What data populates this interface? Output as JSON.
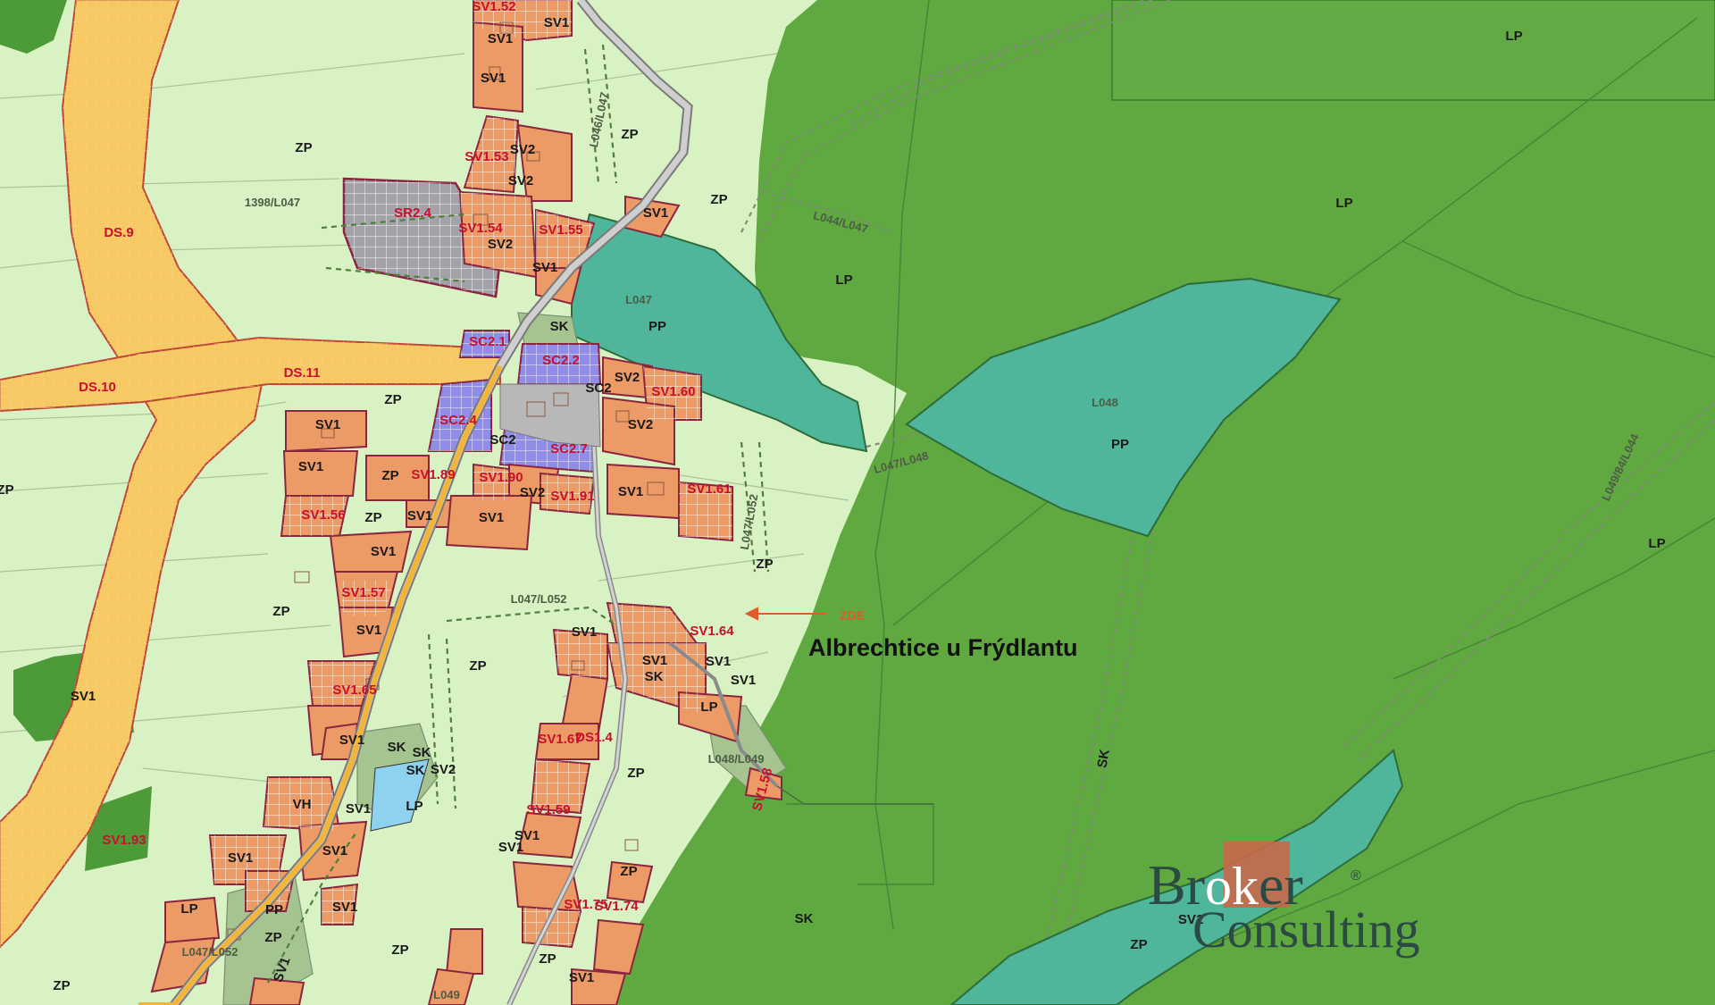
{
  "map": {
    "place_name": "Albrechtice u Frýdlantu",
    "arrow_label": "ZDE",
    "watermark": {
      "line1_prefix": "Br",
      "line1_highlight": "ok",
      "line1_suffix": "er",
      "registered": "®",
      "line2": "Consulting"
    },
    "colors": {
      "meadow": "#d9f2c4",
      "forest": "#60a941",
      "forest_dark": "#4c9a38",
      "water_forest": "#4fb59b",
      "residential": "#ec9a66",
      "commercial": "#8f8de8",
      "recreation": "#a2a2a8",
      "transport": "#f8c862",
      "greenery": "#a5c48f",
      "parcel_border": "#8a2540"
    },
    "labels": [
      {
        "text": "SV1.52",
        "color": "red"
      },
      {
        "text": "SV1",
        "color": "black"
      },
      {
        "text": "SV1",
        "color": "black"
      },
      {
        "text": "SV1",
        "color": "black"
      },
      {
        "text": "ZP",
        "color": "black"
      },
      {
        "text": "ZP",
        "color": "black"
      },
      {
        "text": "SV1.53",
        "color": "red"
      },
      {
        "text": "SV2",
        "color": "black"
      },
      {
        "text": "SV2",
        "color": "black"
      },
      {
        "text": "ZP",
        "color": "black"
      },
      {
        "text": "1398/L047",
        "color": "gray"
      },
      {
        "text": "SR2.4",
        "color": "red"
      },
      {
        "text": "SV1.54",
        "color": "red"
      },
      {
        "text": "SV1.55",
        "color": "red"
      },
      {
        "text": "SV1",
        "color": "black"
      },
      {
        "text": "SV2",
        "color": "black"
      },
      {
        "text": "SV1",
        "color": "black"
      },
      {
        "text": "DS.9",
        "color": "red"
      },
      {
        "text": "L046/L047",
        "color": "gray"
      },
      {
        "text": "L044/L047",
        "color": "gray"
      },
      {
        "text": "LP",
        "color": "black"
      },
      {
        "text": "LP",
        "color": "black"
      },
      {
        "text": "LP",
        "color": "black"
      },
      {
        "text": "L047",
        "color": "gray"
      },
      {
        "text": "PP",
        "color": "black"
      },
      {
        "text": "SK",
        "color": "black"
      },
      {
        "text": "SC2.1",
        "color": "red"
      },
      {
        "text": "SC2.2",
        "color": "red"
      },
      {
        "text": "DS.10",
        "color": "red"
      },
      {
        "text": "DS.11",
        "color": "red"
      },
      {
        "text": "SV2",
        "color": "black"
      },
      {
        "text": "SV1.60",
        "color": "red"
      },
      {
        "text": "SC2",
        "color": "black"
      },
      {
        "text": "ZP",
        "color": "black"
      },
      {
        "text": "SV1",
        "color": "black"
      },
      {
        "text": "SC2.4",
        "color": "red"
      },
      {
        "text": "SC2",
        "color": "black"
      },
      {
        "text": "SV2",
        "color": "black"
      },
      {
        "text": "SC2.7",
        "color": "red"
      },
      {
        "text": "L048",
        "color": "gray"
      },
      {
        "text": "PP",
        "color": "black"
      },
      {
        "text": "L047/L048",
        "color": "gray"
      },
      {
        "text": "SV1",
        "color": "black"
      },
      {
        "text": "ZP",
        "color": "black"
      },
      {
        "text": "SV1.89",
        "color": "red"
      },
      {
        "text": "SV1.90",
        "color": "red"
      },
      {
        "text": "SV2",
        "color": "black"
      },
      {
        "text": "SV1.91",
        "color": "red"
      },
      {
        "text": "SV1",
        "color": "black"
      },
      {
        "text": "SV1.61",
        "color": "red"
      },
      {
        "text": "L047/L052",
        "color": "gray"
      },
      {
        "text": "ZP",
        "color": "black"
      },
      {
        "text": "SV1.56",
        "color": "red"
      },
      {
        "text": "ZP",
        "color": "black"
      },
      {
        "text": "SV1",
        "color": "black"
      },
      {
        "text": "SV1",
        "color": "black"
      },
      {
        "text": "SV1",
        "color": "black"
      },
      {
        "text": "L049/84/L044",
        "color": "gray"
      },
      {
        "text": "LP",
        "color": "black"
      },
      {
        "text": "ZP",
        "color": "black"
      },
      {
        "text": "SV1.57",
        "color": "red"
      },
      {
        "text": "L047/L052",
        "color": "gray"
      },
      {
        "text": "ZP",
        "color": "black"
      },
      {
        "text": "SV1",
        "color": "black"
      },
      {
        "text": "SV1.64",
        "color": "red"
      },
      {
        "text": "SV1",
        "color": "black"
      },
      {
        "text": "ZP",
        "color": "black"
      },
      {
        "text": "SV1",
        "color": "black"
      },
      {
        "text": "SV1",
        "color": "black"
      },
      {
        "text": "SV1.65",
        "color": "red"
      },
      {
        "text": "SK",
        "color": "black"
      },
      {
        "text": "SV1",
        "color": "black"
      },
      {
        "text": "LP",
        "color": "black"
      },
      {
        "text": "SV1",
        "color": "black"
      },
      {
        "text": "SV1",
        "color": "black"
      },
      {
        "text": "DS1.4",
        "color": "red"
      },
      {
        "text": "SK",
        "color": "black"
      },
      {
        "text": "SK",
        "color": "black"
      },
      {
        "text": "SV1.67",
        "color": "red"
      },
      {
        "text": "ZP",
        "color": "black"
      },
      {
        "text": "SK",
        "color": "black"
      },
      {
        "text": "SV2",
        "color": "black"
      },
      {
        "text": "L048/L049",
        "color": "gray"
      },
      {
        "text": "SV1.58",
        "color": "red"
      },
      {
        "text": "SK",
        "color": "black"
      },
      {
        "text": "VH",
        "color": "black"
      },
      {
        "text": "SV1",
        "color": "black"
      },
      {
        "text": "LP",
        "color": "black"
      },
      {
        "text": "SV1",
        "color": "black"
      },
      {
        "text": "SV1.93",
        "color": "red"
      },
      {
        "text": "SV1.59",
        "color": "red"
      },
      {
        "text": "SV1",
        "color": "black"
      },
      {
        "text": "SV1",
        "color": "black"
      },
      {
        "text": "SV1",
        "color": "black"
      },
      {
        "text": "ZP",
        "color": "black"
      },
      {
        "text": "LP",
        "color": "black"
      },
      {
        "text": "PP",
        "color": "black"
      },
      {
        "text": "SV1",
        "color": "black"
      },
      {
        "text": "SV1.74",
        "color": "red"
      },
      {
        "text": "SV1.75",
        "color": "red"
      },
      {
        "text": "SK",
        "color": "black"
      },
      {
        "text": "SV1",
        "color": "black"
      },
      {
        "text": "ZP",
        "color": "black"
      },
      {
        "text": "L047/L052",
        "color": "gray"
      },
      {
        "text": "ZP",
        "color": "black"
      },
      {
        "text": "SV1",
        "color": "black"
      },
      {
        "text": "ZP",
        "color": "black"
      },
      {
        "text": "SV1",
        "color": "black"
      },
      {
        "text": "ZP",
        "color": "black"
      },
      {
        "text": "L049",
        "color": "gray"
      },
      {
        "text": "ZP",
        "color": "black"
      }
    ]
  }
}
